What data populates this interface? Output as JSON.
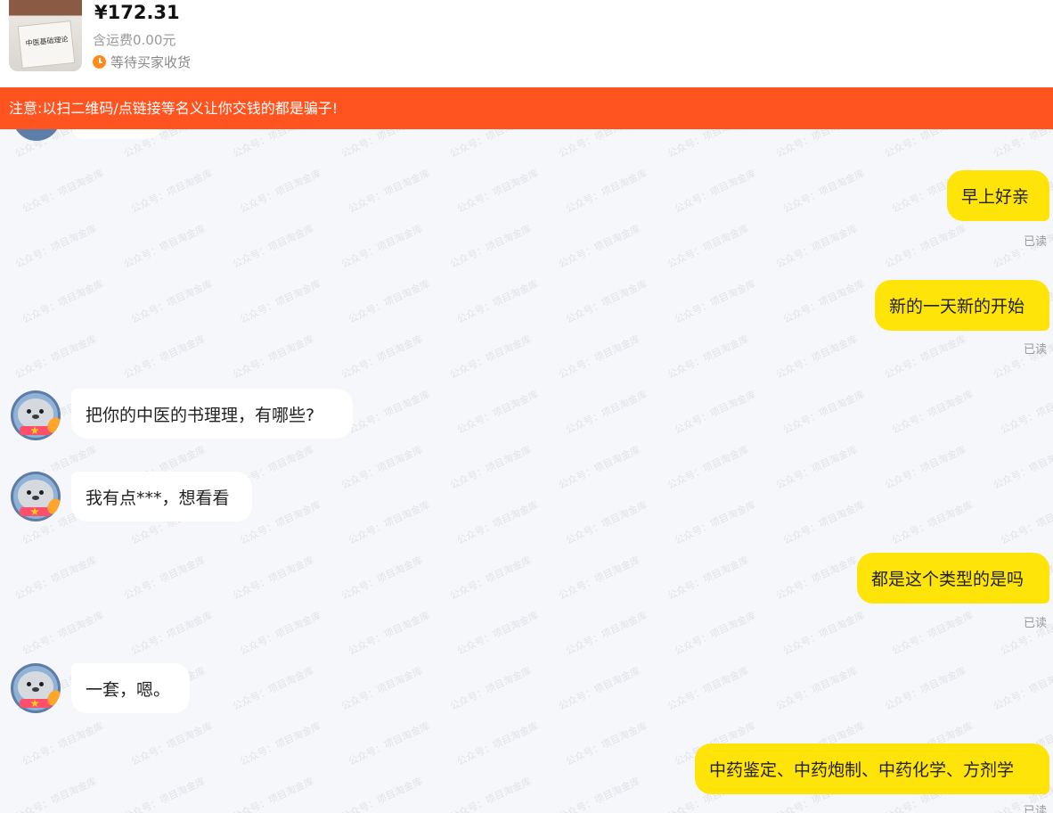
{
  "order": {
    "product_title": "中医基础理论",
    "price": "¥172.31",
    "shipping": "含运费0.00元",
    "status": "等待买家收货"
  },
  "warning": {
    "text": "注意:以扫二维码/点链接等名义让你交钱的都是骗子!"
  },
  "watermark": {
    "text": "公众号：项目淘金库"
  },
  "messages": [
    {
      "side": "right",
      "text": "早上好亲",
      "receipt": "已读"
    },
    {
      "side": "right",
      "text": "新的一天新的开始",
      "receipt": "已读"
    },
    {
      "side": "left",
      "text": "把你的中医的书理理，有哪些?"
    },
    {
      "side": "left",
      "text": "我有点***，想看看"
    },
    {
      "side": "right",
      "text": "都是这个类型的是吗",
      "receipt": "已读"
    },
    {
      "side": "left",
      "text": "一套，嗯。"
    },
    {
      "side": "right",
      "text": "中药鉴定、中药炮制、中药化学、方剂学",
      "receipt": "已读"
    }
  ],
  "colors": {
    "warning_bg": "#ff5320",
    "own_bubble": "#ffe40a",
    "peer_bubble": "#ffffff",
    "background": "#f6f7fb",
    "status_icon": "#ff8a1a"
  }
}
